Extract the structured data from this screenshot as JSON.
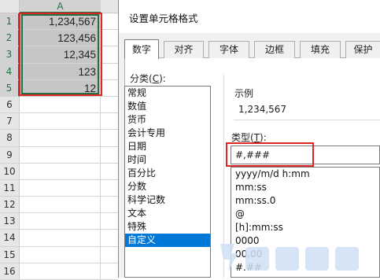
{
  "sheet": {
    "column_header": "A",
    "rows": [
      {
        "n": "1",
        "value": "1,234,567",
        "selected": true
      },
      {
        "n": "2",
        "value": "123,456",
        "selected": true
      },
      {
        "n": "3",
        "value": "12,345",
        "selected": true
      },
      {
        "n": "4",
        "value": "123",
        "selected": true
      },
      {
        "n": "5",
        "value": "12",
        "selected": true
      },
      {
        "n": "6",
        "value": "",
        "selected": false
      },
      {
        "n": "7",
        "value": "",
        "selected": false
      },
      {
        "n": "8",
        "value": "",
        "selected": false
      },
      {
        "n": "9",
        "value": "",
        "selected": false
      },
      {
        "n": "10",
        "value": "",
        "selected": false
      },
      {
        "n": "11",
        "value": "",
        "selected": false
      },
      {
        "n": "12",
        "value": "",
        "selected": false
      },
      {
        "n": "13",
        "value": "",
        "selected": false
      },
      {
        "n": "14",
        "value": "",
        "selected": false
      },
      {
        "n": "15",
        "value": "",
        "selected": false
      },
      {
        "n": "16",
        "value": "",
        "selected": false
      }
    ]
  },
  "dialog": {
    "title": "设置单元格格式",
    "tabs": [
      "数字",
      "对齐",
      "字体",
      "边框",
      "填充",
      "保护"
    ],
    "active_tab": "数字",
    "category_label": "分类(",
    "category_hotkey": "C",
    "category_label_end": "):",
    "categories": [
      "常规",
      "数值",
      "货币",
      "会计专用",
      "日期",
      "时间",
      "百分比",
      "分数",
      "科学记数",
      "文本",
      "特殊",
      "自定义"
    ],
    "selected_category": "自定义",
    "sample_label": "示例",
    "sample_value": "1,234,567",
    "type_label": "类型(",
    "type_hotkey": "T",
    "type_label_end": "):",
    "type_value": "#,###",
    "formats": [
      "yyyy/m/d h:mm",
      "mm:ss",
      "mm:ss.0",
      "@",
      "[h]:mm:ss",
      "0000",
      "00.00",
      "#.##"
    ]
  },
  "colors": {
    "highlight": "#e02424",
    "selection": "#217346",
    "list_selection": "#0078d7"
  }
}
